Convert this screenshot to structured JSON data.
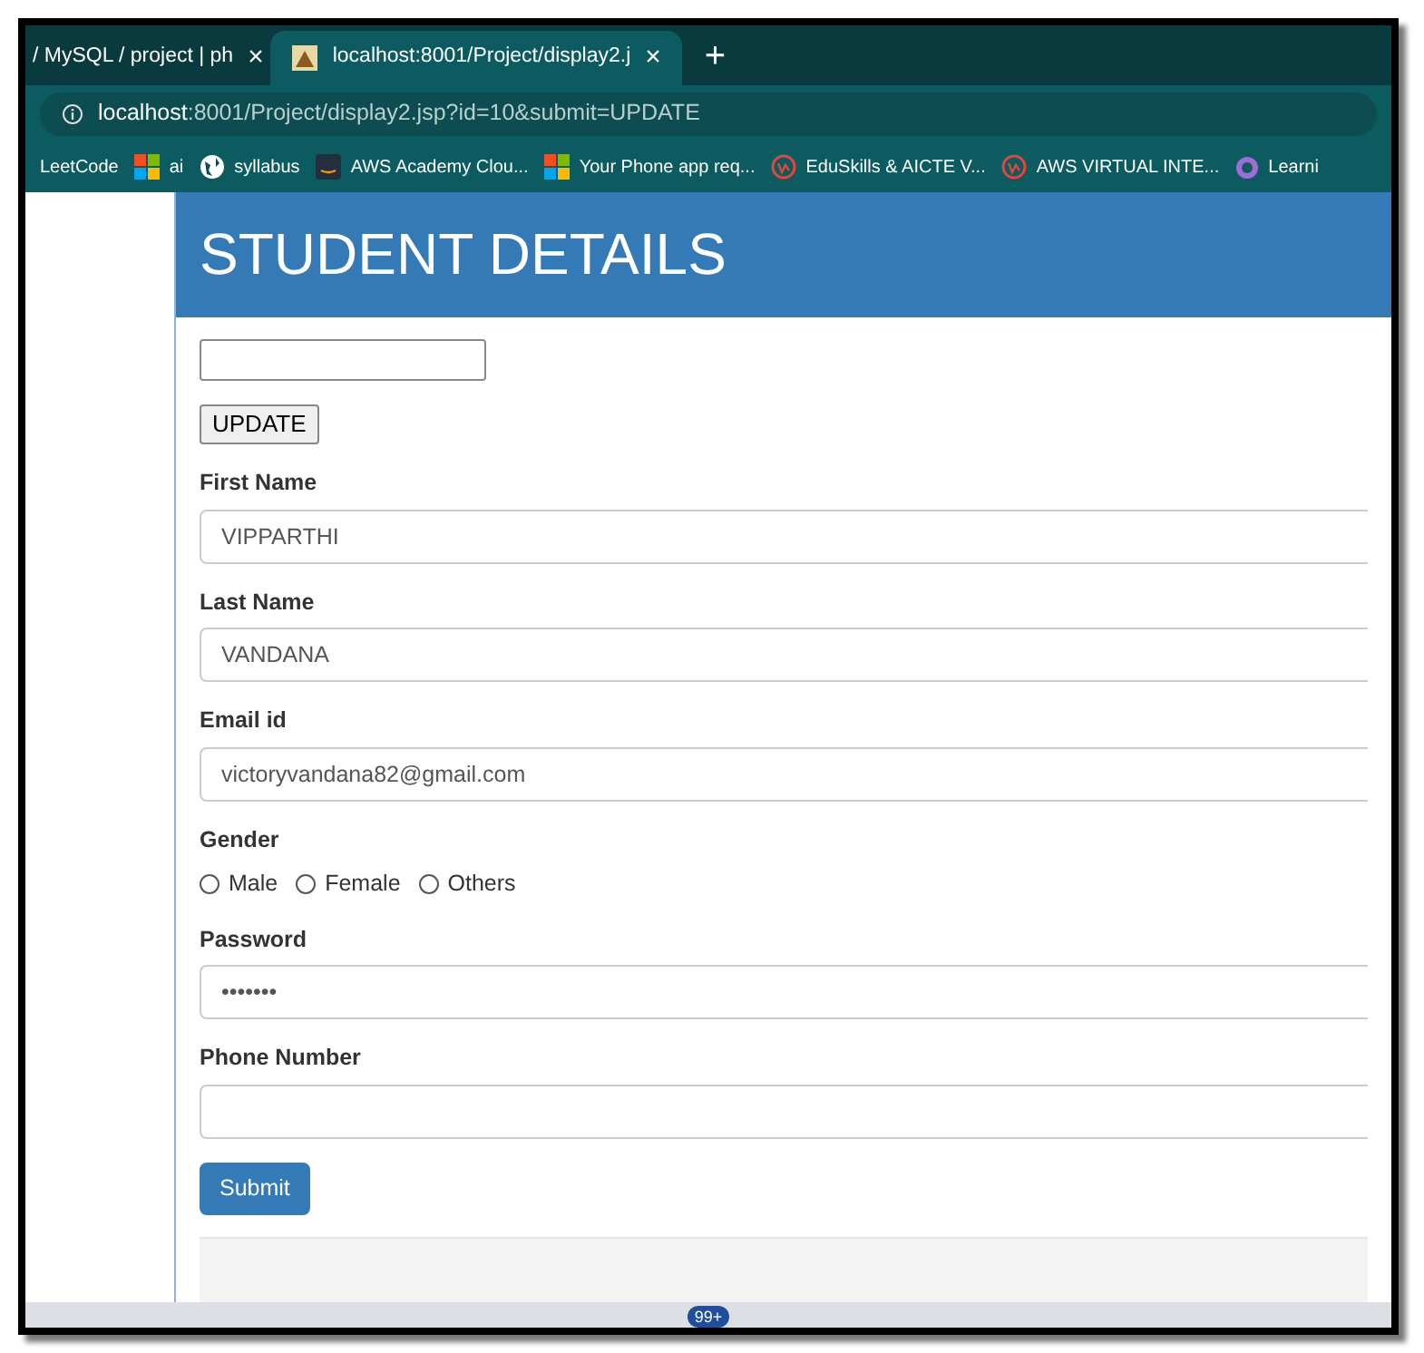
{
  "browser": {
    "tabs": [
      {
        "title": "/ MySQL / project | ph",
        "selected": false,
        "close": "×"
      },
      {
        "title": "localhost:8001/Project/display2.j",
        "selected": true,
        "close": "×"
      }
    ],
    "new_tab": "+",
    "address": {
      "host": "localhost",
      "rest": ":8001/Project/display2.jsp?id=10&submit=UPDATE"
    },
    "bookmarks": [
      {
        "label": "LeetCode",
        "kind": "plain"
      },
      {
        "label": "ai",
        "kind": "windows"
      },
      {
        "label": "syllabus",
        "kind": "globe"
      },
      {
        "label": "AWS Academy Clou...",
        "kind": "aws"
      },
      {
        "label": "Your Phone app req...",
        "kind": "windows"
      },
      {
        "label": "EduSkills & AICTE V...",
        "kind": "ring"
      },
      {
        "label": "AWS VIRTUAL INTE...",
        "kind": "ring"
      },
      {
        "label": "Learni",
        "kind": "loop"
      }
    ]
  },
  "page": {
    "header": "STUDENT DETAILS",
    "update_button": "UPDATE",
    "fields": [
      {
        "kind": "text",
        "label": "First Name",
        "value": "VIPPARTHI"
      },
      {
        "kind": "text",
        "label": "Last Name",
        "value": "VANDANA"
      },
      {
        "kind": "text",
        "label": "Email id",
        "value": "victoryvandana82@gmail.com"
      },
      {
        "kind": "radio",
        "label": "Gender",
        "options": [
          {
            "label": "Male",
            "selected": false
          },
          {
            "label": "Female",
            "selected": false
          },
          {
            "label": "Others",
            "selected": false
          }
        ]
      },
      {
        "kind": "text",
        "label": "Password",
        "value": "•••••••"
      },
      {
        "kind": "text",
        "label": "Phone Number"
      }
    ],
    "submit_button": "Submit"
  },
  "taskbar": {
    "badge": "99+"
  }
}
